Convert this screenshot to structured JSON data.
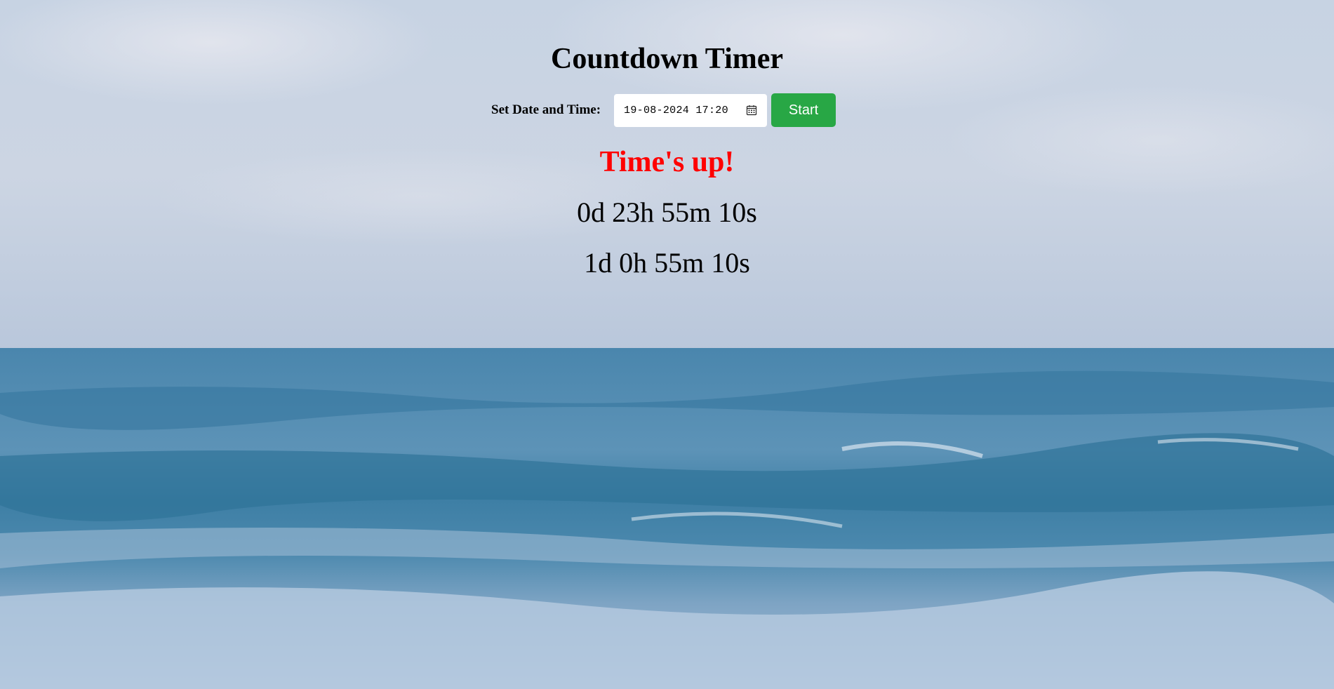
{
  "page": {
    "title": "Countdown Timer"
  },
  "controls": {
    "date_label": "Set Date and Time:",
    "date_value": "19-08-2024 17:20",
    "start_label": "Start"
  },
  "status": {
    "message": "Time's up!"
  },
  "timers": [
    "0d 23h 55m 10s",
    "1d 0h 55m 10s"
  ],
  "icons": {
    "calendar": "calendar-icon"
  },
  "colors": {
    "start_button": "#28a745",
    "status_message": "#ff0000",
    "sky": "#c9d5e4",
    "sea": "#3f7fa6"
  }
}
